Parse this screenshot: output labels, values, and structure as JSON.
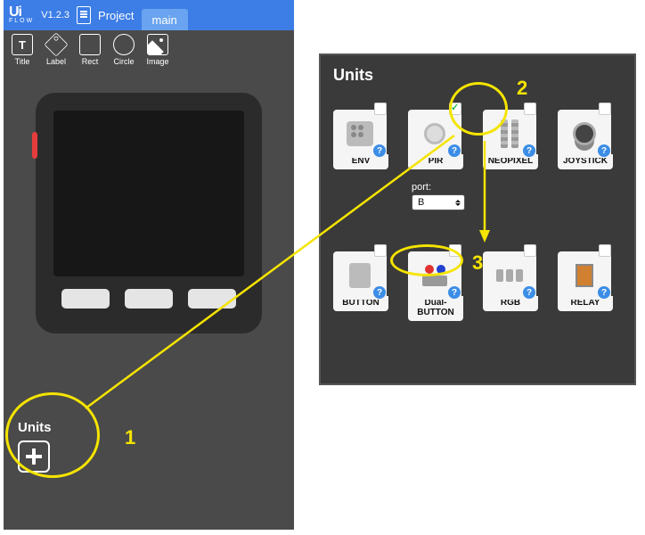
{
  "colors": {
    "accent": "#3c7de6",
    "highlight": "#f5e400"
  },
  "header": {
    "logo_main": "Ui",
    "logo_sub": "FLOW",
    "version": "V1.2.3",
    "project_label": "Project",
    "tab": "main"
  },
  "tools": [
    {
      "name": "title",
      "label": "Title"
    },
    {
      "name": "label",
      "label": "Label"
    },
    {
      "name": "rect",
      "label": "Rect"
    },
    {
      "name": "circle",
      "label": "Circle"
    },
    {
      "name": "image",
      "label": "Image"
    }
  ],
  "left_units": {
    "heading": "Units"
  },
  "units_panel": {
    "title": "Units",
    "port_label": "port:",
    "port_value": "B",
    "row1": [
      {
        "id": "env",
        "label": "ENV",
        "checked": false
      },
      {
        "id": "pir",
        "label": "PIR",
        "checked": true
      },
      {
        "id": "neopixel",
        "label": "NEOPIXEL",
        "checked": false
      },
      {
        "id": "joystick",
        "label": "JOYSTICK",
        "checked": false
      }
    ],
    "row2": [
      {
        "id": "button",
        "label": "BUTTON",
        "checked": false
      },
      {
        "id": "dual",
        "label": "Dual-BUTTON",
        "checked": false
      },
      {
        "id": "rgb",
        "label": "RGB",
        "checked": false
      },
      {
        "id": "relay",
        "label": "RELAY",
        "checked": false
      }
    ]
  },
  "annotations": {
    "n1": "1",
    "n2": "2",
    "n3": "3"
  }
}
